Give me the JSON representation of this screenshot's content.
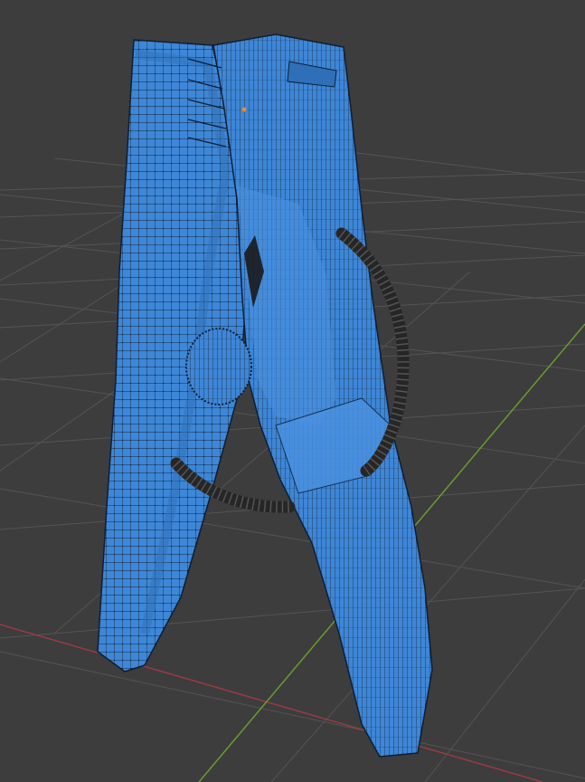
{
  "viewport": {
    "mode": "edit",
    "shading": "solid",
    "background_color": "#3d3d3d",
    "grid_color": "#545454",
    "x_axis_color": "#9a3a44",
    "y_axis_color": "#6a9a2e",
    "mesh_face_color": "#3e86d6",
    "mesh_wire_color": "#0e1e33",
    "spring_color": "#262626",
    "origin_marker_color": "#f08a24"
  },
  "object": {
    "name": "clothespin mesh",
    "parts": [
      "left-jaw",
      "right-jaw",
      "spring",
      "pivot-disk"
    ]
  }
}
